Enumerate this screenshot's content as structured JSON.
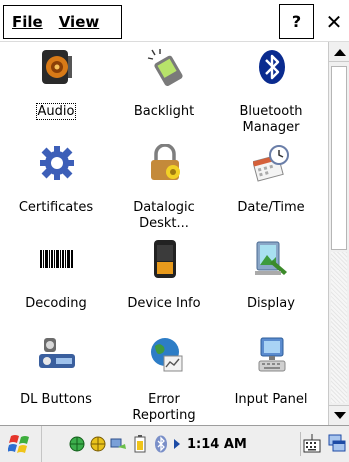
{
  "menubar": {
    "file_label": "File",
    "view_label": "View",
    "help_label": "?",
    "close_label": "✕"
  },
  "items": [
    {
      "label": "Audio",
      "icon": "audio-speaker-icon",
      "selected": true
    },
    {
      "label": "Backlight",
      "icon": "backlight-icon"
    },
    {
      "label": "Bluetooth\nManager",
      "icon": "bluetooth-icon"
    },
    {
      "label": "Certificates",
      "icon": "certificates-gear-icon"
    },
    {
      "label": "Datalogic\nDeskt...",
      "icon": "datalogic-desktop-icon"
    },
    {
      "label": "Date/Time",
      "icon": "date-time-icon"
    },
    {
      "label": "Decoding",
      "icon": "barcode-icon"
    },
    {
      "label": "Device Info",
      "icon": "device-info-icon"
    },
    {
      "label": "Display",
      "icon": "display-icon"
    },
    {
      "label": "DL Buttons",
      "icon": "dl-buttons-icon"
    },
    {
      "label": "Error\nReporting",
      "icon": "error-reporting-icon"
    },
    {
      "label": "Input Panel",
      "icon": "input-panel-icon"
    }
  ],
  "taskbar": {
    "time": "1:14 AM",
    "start_icon": "windows-start-icon",
    "tray_icons": [
      "network-icon",
      "network-icon-2",
      "sync-icon",
      "battery-icon",
      "bluetooth-tray-icon",
      "arrow-right-icon"
    ],
    "keyboard_icon": "keyboard-icon",
    "desktop_icon": "desktop-icon"
  },
  "colors": {
    "selection_border": "#000000",
    "taskbar_bg": "#eeeeee",
    "bluetooth_blue": "#0a2b8f"
  }
}
